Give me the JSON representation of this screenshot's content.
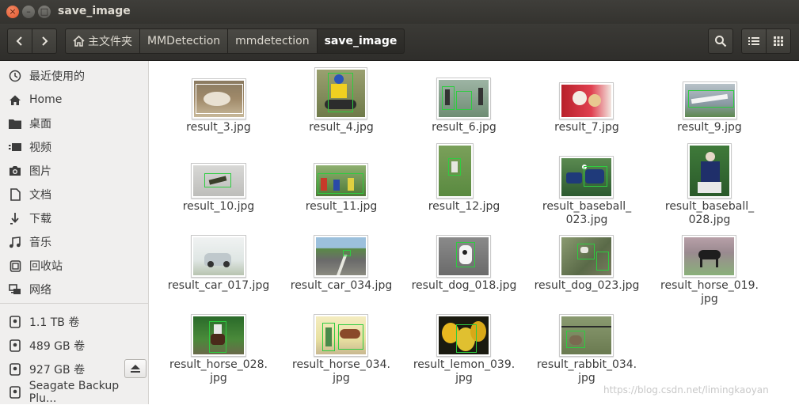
{
  "window": {
    "title": "save_image"
  },
  "titlebar_buttons": {
    "close": "×",
    "min": "–",
    "max": "□"
  },
  "breadcrumbs": [
    "主文件夹",
    "MMDetection",
    "mmdetection",
    "save_image"
  ],
  "sidebar": {
    "places": [
      {
        "label": "最近使用的",
        "icon": "clock-icon"
      },
      {
        "label": "Home",
        "icon": "home-icon"
      },
      {
        "label": "桌面",
        "icon": "folder-icon"
      },
      {
        "label": "视频",
        "icon": "video-icon"
      },
      {
        "label": "图片",
        "icon": "camera-icon"
      },
      {
        "label": "文档",
        "icon": "document-icon"
      },
      {
        "label": "下载",
        "icon": "download-icon"
      },
      {
        "label": "音乐",
        "icon": "music-icon"
      },
      {
        "label": "回收站",
        "icon": "trash-icon"
      },
      {
        "label": "网络",
        "icon": "network-icon"
      }
    ],
    "devices": [
      {
        "label": "1.1 TB 卷",
        "icon": "drive-icon"
      },
      {
        "label": "489 GB 卷",
        "icon": "drive-icon"
      },
      {
        "label": "927 GB 卷",
        "icon": "drive-icon"
      },
      {
        "label": "Seagate Backup Plu...",
        "icon": "drive-icon"
      }
    ]
  },
  "files": [
    {
      "name": "result_3.jpg"
    },
    {
      "name": "result_4.jpg"
    },
    {
      "name": "result_6.jpg"
    },
    {
      "name": "result_7.jpg"
    },
    {
      "name": "result_9.jpg"
    },
    {
      "name": "result_10.jpg"
    },
    {
      "name": "result_11.jpg"
    },
    {
      "name": "result_12.jpg"
    },
    {
      "name": "result_baseball_\n023.jpg"
    },
    {
      "name": "result_baseball_\n028.jpg"
    },
    {
      "name": "result_car_017.jpg"
    },
    {
      "name": "result_car_034.jpg"
    },
    {
      "name": "result_dog_018.jpg"
    },
    {
      "name": "result_dog_023.jpg"
    },
    {
      "name": "result_horse_019.\njpg"
    },
    {
      "name": "result_horse_028.\njpg"
    },
    {
      "name": "result_horse_034.\njpg"
    },
    {
      "name": "result_lemon_039.\njpg"
    },
    {
      "name": "result_rabbit_034.\njpg"
    }
  ],
  "watermark": "https://blog.csdn.net/limingkaoyan"
}
